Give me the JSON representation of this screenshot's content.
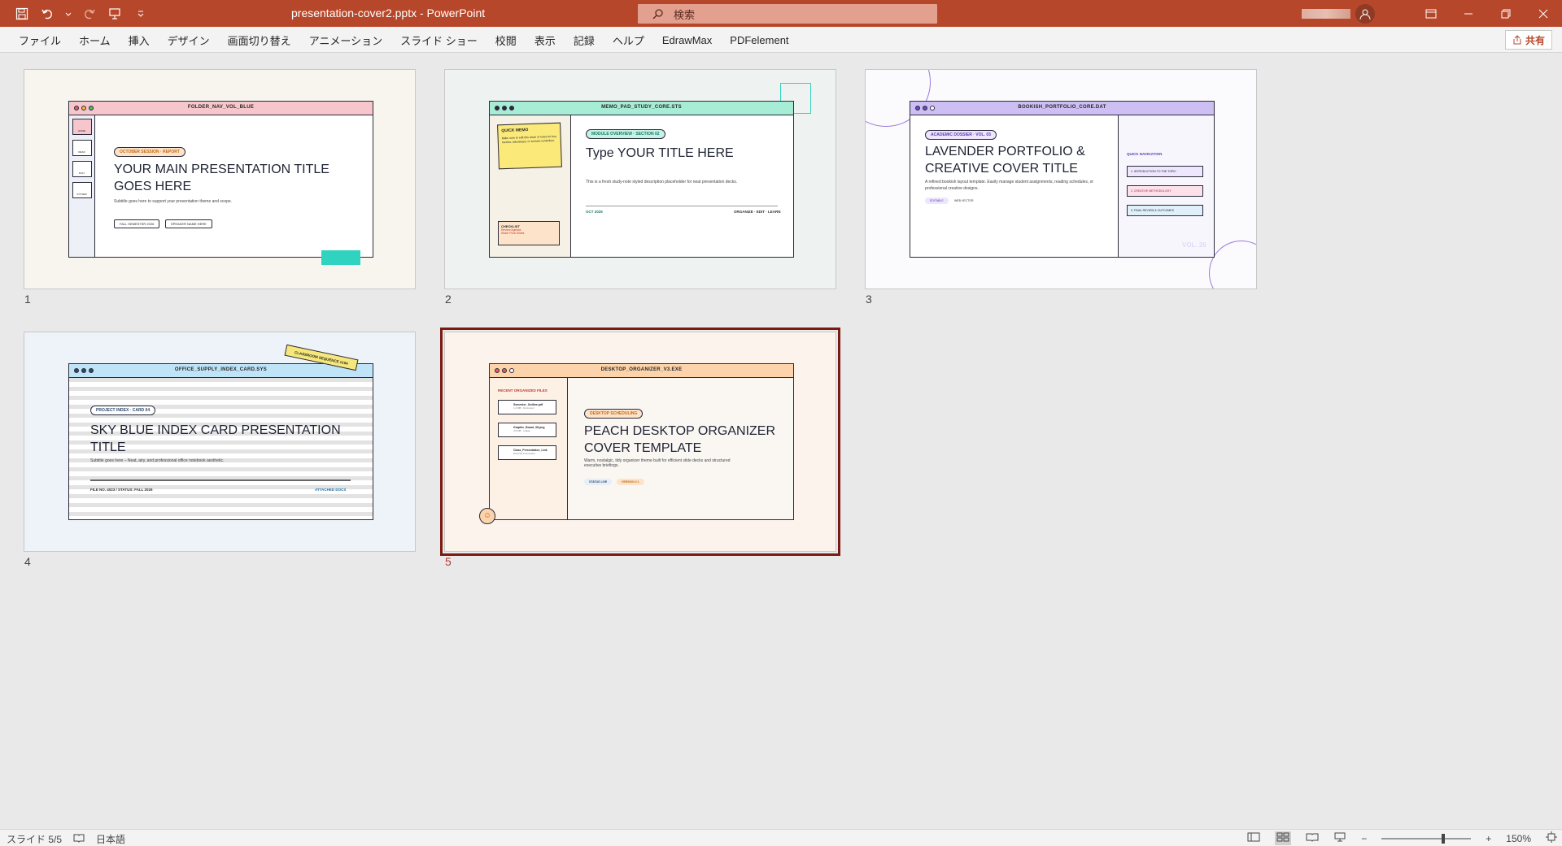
{
  "app": {
    "doc_title": "presentation-cover2.pptx  -  PowerPoint",
    "search_placeholder": "検索",
    "share_label": "共有"
  },
  "menu": [
    "ファイル",
    "ホーム",
    "挿入",
    "デザイン",
    "画面切り替え",
    "アニメーション",
    "スライド ショー",
    "校閲",
    "表示",
    "記録",
    "ヘルプ",
    "EdrawMax",
    "PDFelement"
  ],
  "slides": [
    {
      "number": "1",
      "window_title": "FOLDER_NAV_VOL_BLUE",
      "pill": "OCTOBER SESSION · REPORT",
      "title": "YOUR MAIN PRESENTATION TITLE GOES HERE",
      "subtitle": "Subtitle goes here to support your presentation theme and scope.",
      "tag1": "FALL SEMESTER 2026",
      "tag2": "SPEAKER NAME HERE",
      "side_items": [
        "HOME",
        "READ",
        "PLAY",
        "SYSTEM"
      ]
    },
    {
      "number": "2",
      "window_title": "MEMO_PAD_STUDY_CORE.STS",
      "pill": "MODULE OVERVIEW · SECTION 02",
      "title": "Type YOUR TITLE HERE",
      "desc": "This is a fresh study-note styled description placeholder for neat presentation decks.",
      "memo_title": "QUICK MEMO",
      "memo_text": "Make sure to edit this stack of notes for key metrics, takeaways, or session reminders.",
      "check_title": "CHECKLIST",
      "check_items": [
        "Review Agenda",
        "Share Final Slides"
      ],
      "footer_left": "OCT 2026",
      "footer_right": "ORGANIZE · EDIT · LEARN"
    },
    {
      "number": "3",
      "window_title": "BOOKISH_PORTFOLIO_CORE.DAT",
      "pill": "ACADEMIC DOSSIER · VOL. 03",
      "title": "LAVENDER PORTFOLIO & CREATIVE COVER TITLE",
      "desc": "A refined bookish layout template. Easily manage student assignments, reading schedules, or professional creative designs.",
      "tag1": "EDITABLE",
      "tag2": "WEB VECTOR",
      "right_heading": "QUICK NAVIGATION",
      "right_items": [
        "1. INTRODUCTION TO THE TOPIC",
        "2. CREATIVE METHODOLOGY",
        "3. FINAL REVIEW & OUTCOMES"
      ],
      "watermark": "VOL. 26"
    },
    {
      "number": "4",
      "window_title": "OFFICE_SUPPLY_INDEX_CARD.SYS",
      "sticker": "CLASSROOM SEQUENCE #104",
      "pill": "PROJECT INDEX · CARD 04",
      "title": "SKY BLUE INDEX CARD PRESENTATION TITLE",
      "subtitle": "Subtitle goes here – Neat, airy, and professional office notebook aesthetic.",
      "footer_left": "FILE NO. 4023 / STATUS: FALL 2026",
      "footer_right": "ATTACHED DOCS"
    },
    {
      "number": "5",
      "window_title": "DESKTOP_ORGANIZER_V3.EXE",
      "side_heading": "RECENT ORGANIZED FILES",
      "files": [
        {
          "name": "Semester_Outline.pdf",
          "meta": "1.2 MB · Document"
        },
        {
          "name": "Graphic_Board_08.png",
          "meta": "4.8 MB · Image"
        },
        {
          "name": "Class_Presentation_Link",
          "meta": "External Connection"
        }
      ],
      "pill": "DESKTOP SCHEDULING",
      "title": "PEACH DESKTOP ORGANIZER COVER TEMPLATE",
      "desc": "Warm, nostalgic, tidy organizer theme built for efficient slide decks and structured executive briefings.",
      "tag1": "STATUS LIVE",
      "tag2": "VERSION 2.1"
    }
  ],
  "status": {
    "slide_pos": "スライド 5/5",
    "language": "日本語",
    "zoom": "150%"
  },
  "colors": {
    "accent": "#b7472a",
    "selection": "#7a1a12"
  }
}
